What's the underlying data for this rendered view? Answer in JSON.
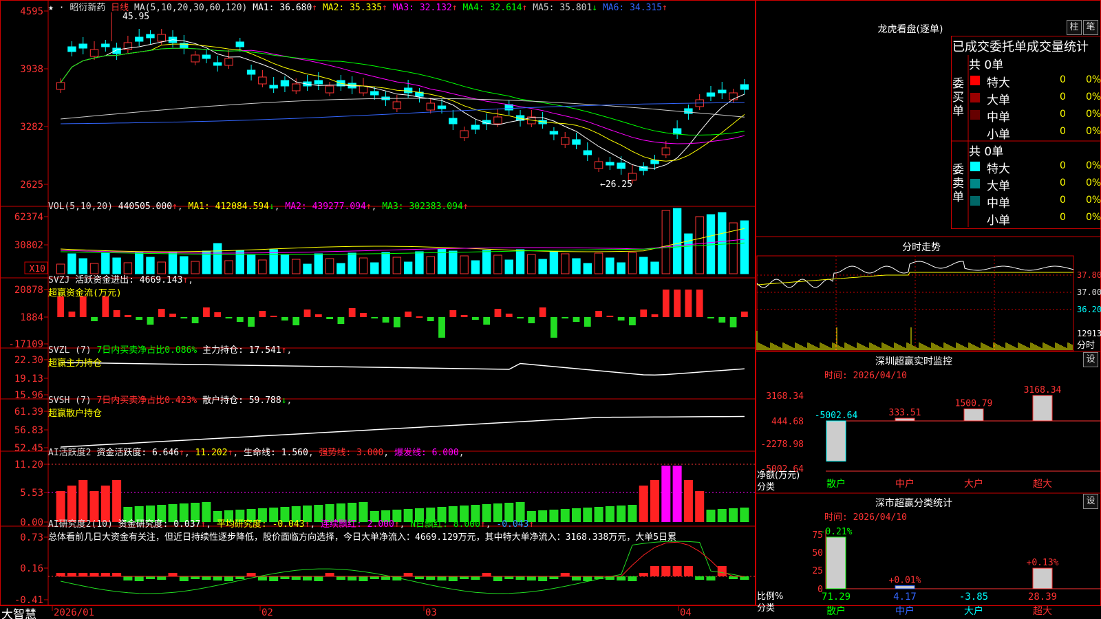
{
  "brand": "大智慧",
  "main": {
    "stock_name": "昭衍新药",
    "period": "日线",
    "ma_label": "MA(5,10,20,30,60,120)",
    "ma": [
      {
        "name": "MA1",
        "value": "36.680",
        "arrow": "↑",
        "color": "#ffffff"
      },
      {
        "name": "MA2",
        "value": "35.335",
        "arrow": "↑",
        "color": "#ffff00"
      },
      {
        "name": "MA3",
        "value": "32.132",
        "arrow": "↑",
        "color": "#ff00ff"
      },
      {
        "name": "MA4",
        "value": "32.614",
        "arrow": "↑",
        "color": "#00ff00"
      },
      {
        "name": "MA5",
        "value": "35.801",
        "arrow": "↓",
        "color": "#cccccc"
      },
      {
        "name": "MA6",
        "value": "34.315",
        "arrow": "↑",
        "color": "#3366ff"
      }
    ],
    "y_labels": [
      "4595",
      "3938",
      "3282",
      "2625"
    ],
    "high_mark": "45.95",
    "low_mark": "←26.25"
  },
  "vol": {
    "label": "VOL(5,10,20)",
    "value": "440505.000",
    "ma1": "412084.594",
    "ma2": "439277.094",
    "ma3": "302383.094",
    "y_labels": [
      "62374",
      "30802"
    ],
    "unit": "X10"
  },
  "svzj": {
    "label": "SVZJ",
    "desc": "活跃资金进出:",
    "value": "4669.143",
    "sub": "超赢资金流(万元)",
    "y_labels": [
      "20878",
      "1884",
      "-17109"
    ]
  },
  "svzl": {
    "label": "SVZL (7)",
    "desc": "7日内买卖净占比0.086%",
    "name2": "主力持仓:",
    "value": "17.541",
    "sub": "超赢主力持仓",
    "y_labels": [
      "22.30",
      "19.13",
      "15.96"
    ]
  },
  "svsh": {
    "label": "SVSH (7)",
    "desc": "7日内买卖净占比0.423%",
    "name2": "散户持仓:",
    "value": "59.788",
    "sub": "超赢散户持仓",
    "y_labels": [
      "61.39",
      "56.83",
      "52.45"
    ]
  },
  "ai_active": {
    "label": "AI活跃度2",
    "desc": "资金活跃度:",
    "v1": "6.646",
    "v2": "11.202",
    "name3": "生命线:",
    "v3": "1.560",
    "name4": "强势线:",
    "v4": "3.000",
    "name5": "爆发线:",
    "v5": "6.000",
    "y_labels": [
      "11.20",
      "5.53",
      "0.00"
    ]
  },
  "ai_research": {
    "label": "AI研究度2(10)",
    "desc": "资金研究度:",
    "v1": "0.037",
    "name2": "平均研究度:",
    "v2": "-0.043",
    "name3": "连续飘红:",
    "v3": "2.000",
    "name4": "N日飘红:",
    "v4": "8.000",
    "v5": "-0.043",
    "summary": "总体看前几日大资金有关注，但近日持续性逐步降低，股价面临方向选择，今日大单净流入：4669.129万元，其中特大单净流入：3168.338万元，大单5日累",
    "y_labels": [
      "0.73",
      "0.16",
      "-0.41"
    ]
  },
  "x_axis": [
    "2026/01",
    "02",
    "03",
    "04"
  ],
  "right": {
    "dragon_title": "龙虎看盘(逐单)",
    "btn_col": "柱",
    "btn_pen": "笔",
    "stats_title": "已成交委托单成交量统计",
    "buy_label": "委买单",
    "sell_label": "委卖单",
    "buy_total": "共 0单",
    "sell_total": "共 0单",
    "buy_rows": [
      {
        "name": "特大",
        "count": "0",
        "pct": "0%",
        "color": "#ff0000"
      },
      {
        "name": "大单",
        "count": "0",
        "pct": "0%",
        "color": "#990000"
      },
      {
        "name": "中单",
        "count": "0",
        "pct": "0%",
        "color": "#660000"
      },
      {
        "name": "小单",
        "count": "0",
        "pct": "0%",
        "color": "#000000"
      }
    ],
    "sell_rows": [
      {
        "name": "特大",
        "count": "0",
        "pct": "0%",
        "color": "#00ffff"
      },
      {
        "name": "大单",
        "count": "0",
        "pct": "0%",
        "color": "#008888"
      },
      {
        "name": "中单",
        "count": "0",
        "pct": "0%",
        "color": "#006666"
      },
      {
        "name": "小单",
        "count": "0",
        "pct": "0%",
        "color": "#000000"
      }
    ],
    "intraday_title": "分时走势",
    "intraday_prices": [
      "37.80",
      "37.00",
      "36.20"
    ],
    "intraday_vol": "12913",
    "intraday_unit": "分时",
    "monitor_title": "深圳超赢实时监控",
    "monitor_setting": "设",
    "monitor_time": "时间: 2026/04/10",
    "monitor_y": [
      "3168.34",
      "444.68",
      "-2278.98",
      "-5002.64"
    ],
    "monitor_ylabel": "净额(万元)",
    "monitor_xcat": "分类",
    "monitor_cats": [
      "散户",
      "中户",
      "大户",
      "超大"
    ],
    "monitor_values": [
      -5002.64,
      333.51,
      1500.79,
      3168.34
    ],
    "monitor_value_labels": [
      "-5002.64",
      "333.51",
      "1500.79",
      "3168.34"
    ],
    "class_title": "深市超赢分类统计",
    "class_setting": "设",
    "class_time": "时间: 2026/04/10",
    "class_y": [
      "75",
      "50",
      "25",
      "0"
    ],
    "class_ylabel": "比例%",
    "class_xcat": "分类",
    "class_cats": [
      "散户",
      "中户",
      "大户",
      "超大"
    ],
    "class_pct": [
      71.29,
      4.17,
      0,
      28.39
    ],
    "class_pct_labels": [
      "71.29",
      "4.17",
      "-3.85",
      "28.39"
    ],
    "class_top_labels": [
      "-0.21%",
      "+0.01%",
      "",
      "+0.13%"
    ]
  }
}
